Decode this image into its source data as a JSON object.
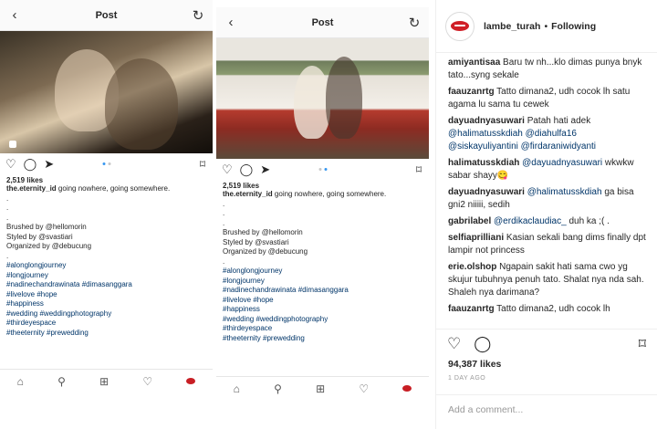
{
  "posts": [
    {
      "title": "Post",
      "likes": "2,519 likes",
      "caption_user": "the.eternity_id",
      "caption_text": "going nowhere, going somewhere.",
      "dots": [
        ".",
        ".",
        "."
      ],
      "credits": [
        "Brushed by @hellomorin",
        "Styled by @svastiari",
        "Organized by @debucung"
      ],
      "tags": [
        "#alonglongjourney",
        "#longjourney",
        "#nadinechandrawinata #dimasanggara",
        "#livelove #hope",
        "#happiness",
        "#wedding #weddingphotography",
        "#thirdeyespace",
        "#theeternity #prewedding"
      ]
    },
    {
      "title": "Post",
      "likes": "2,519 likes",
      "caption_user": "the.eternity_id",
      "caption_text": "going nowhere, going somewhere.",
      "dots": [
        ".",
        ".",
        "."
      ],
      "credits": [
        "Brushed by @hellomorin",
        "Styled by @svastiari",
        "Organized by @debucung"
      ],
      "tags": [
        "#alonglongjourney",
        "#longjourney",
        "#nadinechandrawinata #dimasanggara",
        "#livelove #hope",
        "#happiness",
        "#wedding #weddingphotography",
        "#thirdeyespace",
        "#theeternity #prewedding"
      ]
    }
  ],
  "panel": {
    "username": "lambe_turah",
    "separator": "•",
    "follow_status": "Following",
    "comments": [
      {
        "user": "amiyantisaa",
        "text": "Baru tw nh...klo dimas punya bnyk tato...syng sekale"
      },
      {
        "user": "faauzanrtg",
        "text": "Tatto dimana2, udh cocok lh satu agama lu sama tu cewek"
      },
      {
        "user": "dayuadnyasuwari",
        "text": "Patah hati adek",
        "mentions": "@halimatusskdiah @diahulfa16 @siskayuliyantini @firdaraniwidyanti"
      },
      {
        "user": "halimatusskdiah",
        "mentions": "@dayuadnyasuwari",
        "text": "wkwkw sabar shayy😋"
      },
      {
        "user": "dayuadnyasuwari",
        "mentions": "@halimatusskdiah",
        "text": "ga bisa gni2 niiiii, sedih"
      },
      {
        "user": "gabrilabel",
        "mentions": "@erdikaclaudiac_",
        "text": "duh ka ;( ."
      },
      {
        "user": "selfiaprilliani",
        "text": "Kasian sekali bang dims finally dpt lampir not princess"
      },
      {
        "user": "erie.olshop",
        "text": "Ngapain sakit hati sama cwo yg skujur tubuhnya penuh tato. Shalat nya nda sah. Shaleh nya darimana?"
      },
      {
        "user": "faauzanrtg",
        "text": "Tatto dimana2, udh cocok lh"
      }
    ],
    "likes": "94,387 likes",
    "time_ago": "1 DAY AGO",
    "add_comment_placeholder": "Add a comment..."
  },
  "icons": {
    "back": "‹",
    "refresh": "↻",
    "heart": "♡",
    "comment": "◯",
    "share": "➤",
    "bookmark": "⌑",
    "home": "⌂",
    "search": "⚲",
    "add": "⊞"
  },
  "colors": {
    "link": "#003569",
    "active_dot": "#3897f0",
    "lips": "#c81e24"
  }
}
